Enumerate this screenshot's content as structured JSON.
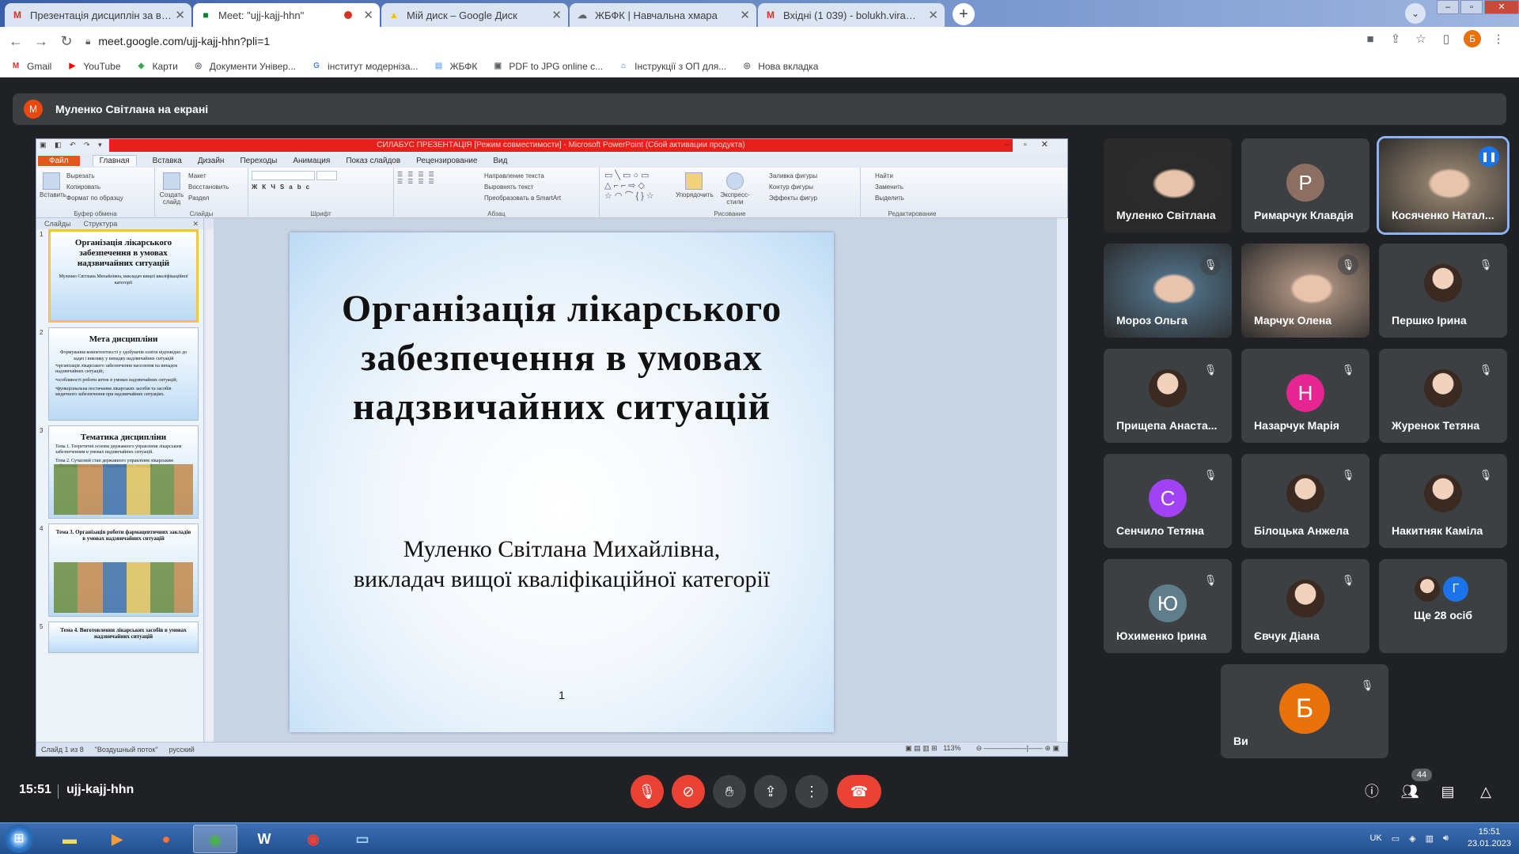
{
  "browser": {
    "tabs": [
      {
        "title": "Презентація дисциплін за вибор",
        "icon": "gmail-icon",
        "icon_char": "M",
        "icon_color": "#d93025",
        "active": false
      },
      {
        "title": "Meet: \"ujj-kajj-hhn\"",
        "icon": "meet-icon",
        "icon_char": "■",
        "icon_color": "#00832d",
        "active": true,
        "recording": true
      },
      {
        "title": "Мій диск – Google Диск",
        "icon": "drive-icon",
        "icon_char": "▲",
        "icon_color": "#fbbc04",
        "active": false
      },
      {
        "title": "ЖБФК | Навчальна хмара",
        "icon": "cloud-icon",
        "icon_char": "☁",
        "icon_color": "#5f6368",
        "active": false
      },
      {
        "title": "Вхідні (1 039) - bolukh.vira@pha",
        "icon": "gmail-icon",
        "icon_char": "M",
        "icon_color": "#d93025",
        "active": false
      }
    ],
    "url": "meet.google.com/ujj-kajj-hhn?pli=1",
    "profile_initial": "Б",
    "bookmarks": [
      {
        "label": "Gmail",
        "icon": "gmail-icon",
        "char": "M",
        "color": "#d93025"
      },
      {
        "label": "YouTube",
        "icon": "youtube-icon",
        "char": "▶",
        "color": "#ff0000"
      },
      {
        "label": "Карти",
        "icon": "maps-icon",
        "char": "◆",
        "color": "#34a853"
      },
      {
        "label": "Документи Універ...",
        "icon": "globe-icon",
        "char": "◎",
        "color": "#5f6368"
      },
      {
        "label": "інститут модерніза...",
        "icon": "google-icon",
        "char": "G",
        "color": "#4285f4"
      },
      {
        "label": "ЖБФК",
        "icon": "page-icon",
        "char": "▤",
        "color": "#8ab4f8"
      },
      {
        "label": "PDF to JPG online c...",
        "icon": "pdf-icon",
        "char": "▣",
        "color": "#5f6368"
      },
      {
        "label": "Інструкції з ОП для...",
        "icon": "home-icon",
        "char": "⌂",
        "color": "#1a73e8"
      },
      {
        "label": "Нова вкладка",
        "icon": "globe-icon",
        "char": "◎",
        "color": "#5f6368"
      }
    ]
  },
  "meet": {
    "presenter_initial": "М",
    "presenter_banner": "Муленко Світлана на екрані",
    "time": "15:51",
    "code": "ujj-kajj-hhn",
    "participant_count": "44",
    "participants": [
      {
        "name": "Муленко Світлана",
        "type": "video",
        "muted": false
      },
      {
        "name": "Римарчук Клавдія",
        "type": "avatar",
        "initial": "Р",
        "color": "#8d6e63",
        "muted": false
      },
      {
        "name": "Косяченко Натал...",
        "type": "video",
        "muted": false,
        "speaking": true
      },
      {
        "name": "Мороз Ольга",
        "type": "video",
        "muted": true
      },
      {
        "name": "Марчук Олена",
        "type": "video",
        "muted": true
      },
      {
        "name": "Першко Ірина",
        "type": "photo",
        "muted": true
      },
      {
        "name": "Прищепа Анаста...",
        "type": "photo",
        "muted": true
      },
      {
        "name": "Назарчук Марія",
        "type": "avatar",
        "initial": "Н",
        "color": "#e52592",
        "muted": true
      },
      {
        "name": "Журенок Тетяна",
        "type": "photo",
        "muted": true
      },
      {
        "name": "Сенчило Тетяна",
        "type": "avatar",
        "initial": "С",
        "color": "#a142f4",
        "muted": true
      },
      {
        "name": "Білоцька Анжела",
        "type": "photo",
        "muted": true
      },
      {
        "name": "Накитняк Каміла",
        "type": "photo",
        "muted": true
      },
      {
        "name": "Юхименко Ірина",
        "type": "avatar",
        "initial": "Ю",
        "color": "#607d8b",
        "muted": true
      },
      {
        "name": "Євчук Діана",
        "type": "photo",
        "muted": true
      },
      {
        "name": "Ще 28 осіб",
        "type": "more",
        "initial": "Г",
        "muted": false
      },
      {
        "name": "Ви",
        "type": "avatar-large",
        "initial": "Б",
        "color": "#e8710a",
        "muted": true
      }
    ]
  },
  "powerpoint": {
    "window_title": "СИЛАБУС ПРЕЗЕНТАЦІЯ [Режим совместимости] - Microsoft PowerPoint (Сбой активации продукта)",
    "ribbon_tabs": [
      "Файл",
      "Главная",
      "Вставка",
      "Дизайн",
      "Переходы",
      "Анимация",
      "Показ слайдов",
      "Рецензирование",
      "Вид"
    ],
    "ribbon_groups": {
      "clipboard": {
        "paste": "Вставить",
        "cut": "Вырезать",
        "copy": "Копировать",
        "format": "Формат по образцу",
        "label": "Буфер обмена"
      },
      "slides": {
        "new": "Создать слайд",
        "layout": "Макет",
        "reset": "Восстановить",
        "section": "Раздел",
        "label": "Слайды"
      },
      "font": {
        "label": "Шрифт"
      },
      "paragraph": {
        "dir": "Направление текста",
        "align": "Выровнять текст",
        "smart": "Преобразовать в SmartArt",
        "label": "Абзац"
      },
      "drawing": {
        "arrange": "Упорядочить",
        "styles": "Экспресс-стили",
        "fill": "Заливка фигуры",
        "outline": "Контур фигуры",
        "effects": "Эффекты фигур",
        "label": "Рисование"
      },
      "editing": {
        "find": "Найти",
        "replace": "Заменить",
        "select": "Выделить",
        "label": "Редактирование"
      }
    },
    "pane_tabs": [
      "Слайды",
      "Структура"
    ],
    "thumbnails": [
      {
        "num": "1",
        "title": "Організація лікарського забезпечення в умовах надзвичайних ситуацій",
        "sub": "Муленко Світлана Михайлівна, викладач вищої кваліфікаційної категорії"
      },
      {
        "num": "2",
        "title": "Мета дисципліни",
        "sub": "Формування компетентності у здобувачів освіти відповідно до задач і виклику у випадку надзвичайних ситуацій",
        "items": [
          "•організація лікарського забезпечення населення на випадок надзвичайних ситуацій;",
          "•особливості роботи аптек в умовах надзвичайних ситуацій;",
          "•функціональна постачання лікарських засобів та засобів медичного забезпечення при надзвичайних ситуаціях."
        ]
      },
      {
        "num": "3",
        "title": "Тематика дисципліни",
        "items": [
          "Тема 1. Теоретичні основи державного управління лікарським забезпеченням в умовах надзвичайних ситуацій.",
          "Тема 2. Сучасний стан державного управління лікарським забезпеченням в умовах надзвичайних ситуацій."
        ]
      },
      {
        "num": "4",
        "title": "Тема 3. Організація роботи фармацевтичних закладів в умовах надзвичайних ситуацій"
      },
      {
        "num": "5",
        "title": "Тема 4. Виготовлення лікарських засобів в умовах надзвичайних ситуацій"
      }
    ],
    "slide": {
      "title": "Організація лікарського забезпечення в умовах надзвичайних ситуацій",
      "subtitle_line1": "Муленко  Світлана Михайлівна,",
      "subtitle_line2": "викладач вищої кваліфікаційної категорії",
      "number": "1"
    },
    "status": {
      "slide": "Слайд 1 из 8",
      "theme": "\"Воздушный поток\"",
      "lang": "русский",
      "zoom": "113%"
    }
  },
  "taskbar": {
    "lang": "UK",
    "time": "15:51",
    "date": "23.01.2023"
  }
}
